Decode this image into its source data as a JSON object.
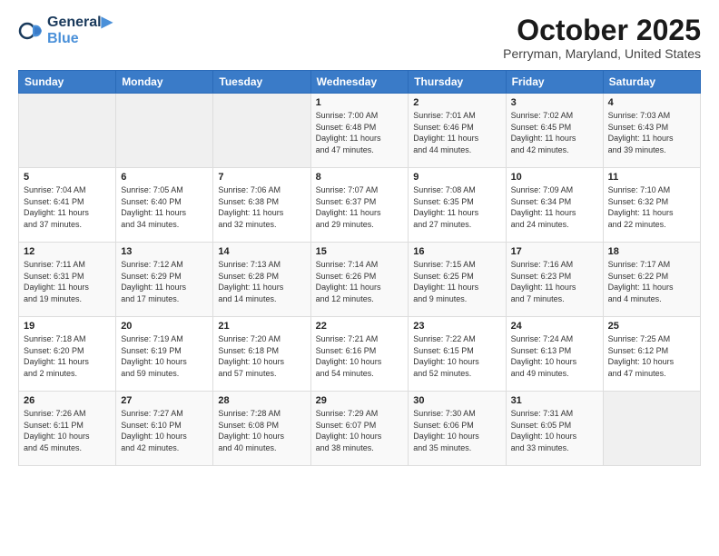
{
  "header": {
    "logo_line1": "General",
    "logo_line2": "Blue",
    "month": "October 2025",
    "location": "Perryman, Maryland, United States"
  },
  "days_of_week": [
    "Sunday",
    "Monday",
    "Tuesday",
    "Wednesday",
    "Thursday",
    "Friday",
    "Saturday"
  ],
  "weeks": [
    [
      {
        "day": "",
        "info": ""
      },
      {
        "day": "",
        "info": ""
      },
      {
        "day": "",
        "info": ""
      },
      {
        "day": "1",
        "info": "Sunrise: 7:00 AM\nSunset: 6:48 PM\nDaylight: 11 hours\nand 47 minutes."
      },
      {
        "day": "2",
        "info": "Sunrise: 7:01 AM\nSunset: 6:46 PM\nDaylight: 11 hours\nand 44 minutes."
      },
      {
        "day": "3",
        "info": "Sunrise: 7:02 AM\nSunset: 6:45 PM\nDaylight: 11 hours\nand 42 minutes."
      },
      {
        "day": "4",
        "info": "Sunrise: 7:03 AM\nSunset: 6:43 PM\nDaylight: 11 hours\nand 39 minutes."
      }
    ],
    [
      {
        "day": "5",
        "info": "Sunrise: 7:04 AM\nSunset: 6:41 PM\nDaylight: 11 hours\nand 37 minutes."
      },
      {
        "day": "6",
        "info": "Sunrise: 7:05 AM\nSunset: 6:40 PM\nDaylight: 11 hours\nand 34 minutes."
      },
      {
        "day": "7",
        "info": "Sunrise: 7:06 AM\nSunset: 6:38 PM\nDaylight: 11 hours\nand 32 minutes."
      },
      {
        "day": "8",
        "info": "Sunrise: 7:07 AM\nSunset: 6:37 PM\nDaylight: 11 hours\nand 29 minutes."
      },
      {
        "day": "9",
        "info": "Sunrise: 7:08 AM\nSunset: 6:35 PM\nDaylight: 11 hours\nand 27 minutes."
      },
      {
        "day": "10",
        "info": "Sunrise: 7:09 AM\nSunset: 6:34 PM\nDaylight: 11 hours\nand 24 minutes."
      },
      {
        "day": "11",
        "info": "Sunrise: 7:10 AM\nSunset: 6:32 PM\nDaylight: 11 hours\nand 22 minutes."
      }
    ],
    [
      {
        "day": "12",
        "info": "Sunrise: 7:11 AM\nSunset: 6:31 PM\nDaylight: 11 hours\nand 19 minutes."
      },
      {
        "day": "13",
        "info": "Sunrise: 7:12 AM\nSunset: 6:29 PM\nDaylight: 11 hours\nand 17 minutes."
      },
      {
        "day": "14",
        "info": "Sunrise: 7:13 AM\nSunset: 6:28 PM\nDaylight: 11 hours\nand 14 minutes."
      },
      {
        "day": "15",
        "info": "Sunrise: 7:14 AM\nSunset: 6:26 PM\nDaylight: 11 hours\nand 12 minutes."
      },
      {
        "day": "16",
        "info": "Sunrise: 7:15 AM\nSunset: 6:25 PM\nDaylight: 11 hours\nand 9 minutes."
      },
      {
        "day": "17",
        "info": "Sunrise: 7:16 AM\nSunset: 6:23 PM\nDaylight: 11 hours\nand 7 minutes."
      },
      {
        "day": "18",
        "info": "Sunrise: 7:17 AM\nSunset: 6:22 PM\nDaylight: 11 hours\nand 4 minutes."
      }
    ],
    [
      {
        "day": "19",
        "info": "Sunrise: 7:18 AM\nSunset: 6:20 PM\nDaylight: 11 hours\nand 2 minutes."
      },
      {
        "day": "20",
        "info": "Sunrise: 7:19 AM\nSunset: 6:19 PM\nDaylight: 10 hours\nand 59 minutes."
      },
      {
        "day": "21",
        "info": "Sunrise: 7:20 AM\nSunset: 6:18 PM\nDaylight: 10 hours\nand 57 minutes."
      },
      {
        "day": "22",
        "info": "Sunrise: 7:21 AM\nSunset: 6:16 PM\nDaylight: 10 hours\nand 54 minutes."
      },
      {
        "day": "23",
        "info": "Sunrise: 7:22 AM\nSunset: 6:15 PM\nDaylight: 10 hours\nand 52 minutes."
      },
      {
        "day": "24",
        "info": "Sunrise: 7:24 AM\nSunset: 6:13 PM\nDaylight: 10 hours\nand 49 minutes."
      },
      {
        "day": "25",
        "info": "Sunrise: 7:25 AM\nSunset: 6:12 PM\nDaylight: 10 hours\nand 47 minutes."
      }
    ],
    [
      {
        "day": "26",
        "info": "Sunrise: 7:26 AM\nSunset: 6:11 PM\nDaylight: 10 hours\nand 45 minutes."
      },
      {
        "day": "27",
        "info": "Sunrise: 7:27 AM\nSunset: 6:10 PM\nDaylight: 10 hours\nand 42 minutes."
      },
      {
        "day": "28",
        "info": "Sunrise: 7:28 AM\nSunset: 6:08 PM\nDaylight: 10 hours\nand 40 minutes."
      },
      {
        "day": "29",
        "info": "Sunrise: 7:29 AM\nSunset: 6:07 PM\nDaylight: 10 hours\nand 38 minutes."
      },
      {
        "day": "30",
        "info": "Sunrise: 7:30 AM\nSunset: 6:06 PM\nDaylight: 10 hours\nand 35 minutes."
      },
      {
        "day": "31",
        "info": "Sunrise: 7:31 AM\nSunset: 6:05 PM\nDaylight: 10 hours\nand 33 minutes."
      },
      {
        "day": "",
        "info": ""
      }
    ]
  ]
}
